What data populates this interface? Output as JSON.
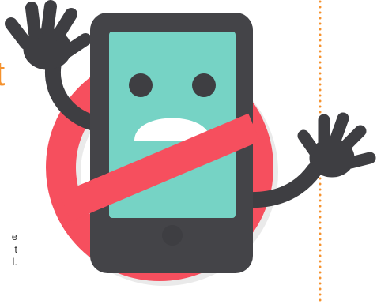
{
  "colors": {
    "accent": "#f5922e",
    "prohibition_red": "#f64f5e",
    "device_dark": "#444448",
    "screen_teal": "#76d3c5",
    "limb_dark": "#3e3e42"
  },
  "text_fragments": {
    "title_fragment": "t",
    "body_lines": [
      "e",
      "t",
      "l."
    ]
  },
  "illustration": {
    "icon": "no-phone-icon"
  }
}
